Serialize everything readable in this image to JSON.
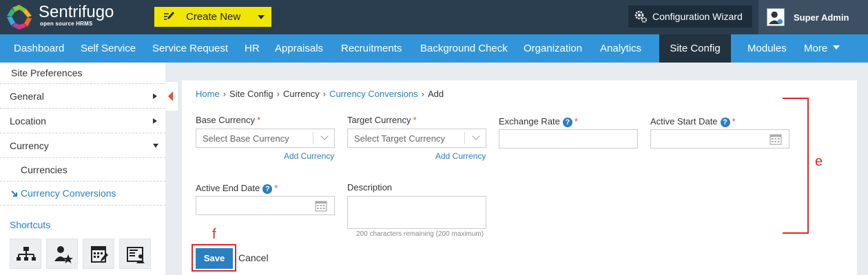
{
  "topbar": {
    "brand": "Sentrifugo",
    "brand_sub": "open source HRMS",
    "create_new": "Create New",
    "config_wizard": "Configuration Wizard",
    "user": "Super Admin"
  },
  "nav": {
    "items": [
      "Dashboard",
      "Self Service",
      "Service Request",
      "HR",
      "Appraisals",
      "Recruitments",
      "Background Check",
      "Organization",
      "Analytics",
      "Site Config",
      "Modules",
      "More"
    ],
    "active": "Site Config"
  },
  "sidebar": {
    "items": [
      "Site Preferences",
      "General",
      "Location",
      "Currency",
      "Currencies",
      "Currency Conversions"
    ],
    "shortcuts_title": "Shortcuts",
    "shortcut_icons": [
      "org-chart-icon",
      "user-star-icon",
      "calendar-edit-icon",
      "id-card-icon"
    ]
  },
  "breadcrumb": {
    "items": [
      "Home",
      "Site Config",
      "Currency",
      "Currency Conversions",
      "Add"
    ],
    "separator": "›"
  },
  "form": {
    "base_currency_label": "Base Currency",
    "base_currency_placeholder": "Select Base Currency",
    "target_currency_label": "Target Currency",
    "target_currency_placeholder": "Select Target Currency",
    "add_currency": "Add Currency",
    "exchange_rate_label": "Exchange Rate",
    "active_start_label": "Active Start Date",
    "active_end_label": "Active End Date",
    "description_label": "Description",
    "description_hint": "200 characters remaining (200 maximum)",
    "required_mark": "*",
    "help_mark": "?",
    "save": "Save",
    "cancel": "Cancel"
  },
  "annotations": {
    "e": "e",
    "f": "f"
  },
  "colors": {
    "topbar": "#2b3e50",
    "nav": "#3295d9",
    "nav_active": "#23323f",
    "create_new": "#f0e600",
    "link": "#2a7fc0",
    "annotation": "#e32626"
  }
}
